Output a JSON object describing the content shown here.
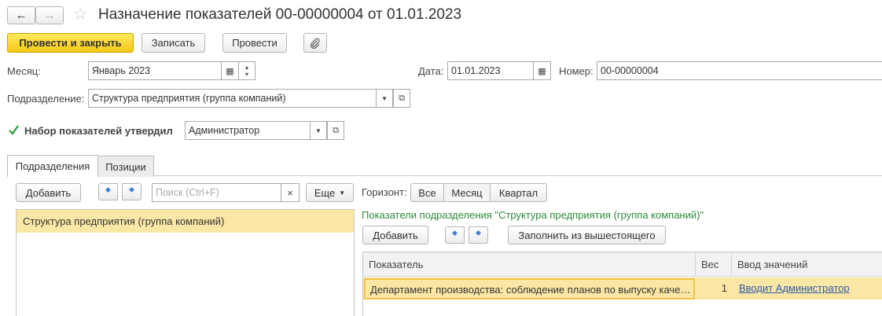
{
  "window": {
    "title": "Назначение показателей 00-00000004 от 01.01.2023"
  },
  "toolbar": {
    "post_close_label": "Провести и закрыть",
    "save_label": "Записать",
    "post_label": "Провести"
  },
  "form": {
    "month_label": "Месяц:",
    "month_value": "Январь 2023",
    "date_label": "Дата:",
    "date_value": "01.01.2023",
    "number_label": "Номер:",
    "number_value": "00-00000004",
    "department_label": "Подразделение:",
    "department_value": "Структура предприятия (группа компаний)",
    "approved_label": "Набор показателей утвердил",
    "approved_checked": true,
    "approved_by_value": "Администратор"
  },
  "tabs": [
    {
      "label": "Подразделения",
      "active": true
    },
    {
      "label": "Позиции",
      "active": false
    }
  ],
  "left_panel": {
    "add_label": "Добавить",
    "search_placeholder": "Поиск (Ctrl+F)",
    "clear_label": "×",
    "more_label": "Еще",
    "items": [
      {
        "label": "Структура предприятия (группа компаний)",
        "selected": true
      }
    ]
  },
  "right_panel": {
    "horizon_label": "Горизонт:",
    "horizon_options": [
      {
        "label": "Все",
        "active": false
      },
      {
        "label": "Месяц",
        "active": true
      },
      {
        "label": "Квартал",
        "active": false
      }
    ],
    "caption": "Показатели подразделения \"Структура предприятия (группа компаний)\"",
    "add_label": "Добавить",
    "fill_label": "Заполнить из вышестоящего",
    "columns": [
      "Показатель",
      "Вес",
      "Ввод значений"
    ],
    "rows": [
      {
        "indicator": "Департамент производства: соблюдение планов по выпуску каче…",
        "weight": "1",
        "input": "Вводит Администратор"
      }
    ]
  },
  "colors": {
    "accent_yellow": "#f6c915",
    "selection": "#fbe7a5",
    "caption_green": "#2f8a3c",
    "link_blue": "#2a5aa8",
    "arrow_blue": "#3a7bd5"
  }
}
